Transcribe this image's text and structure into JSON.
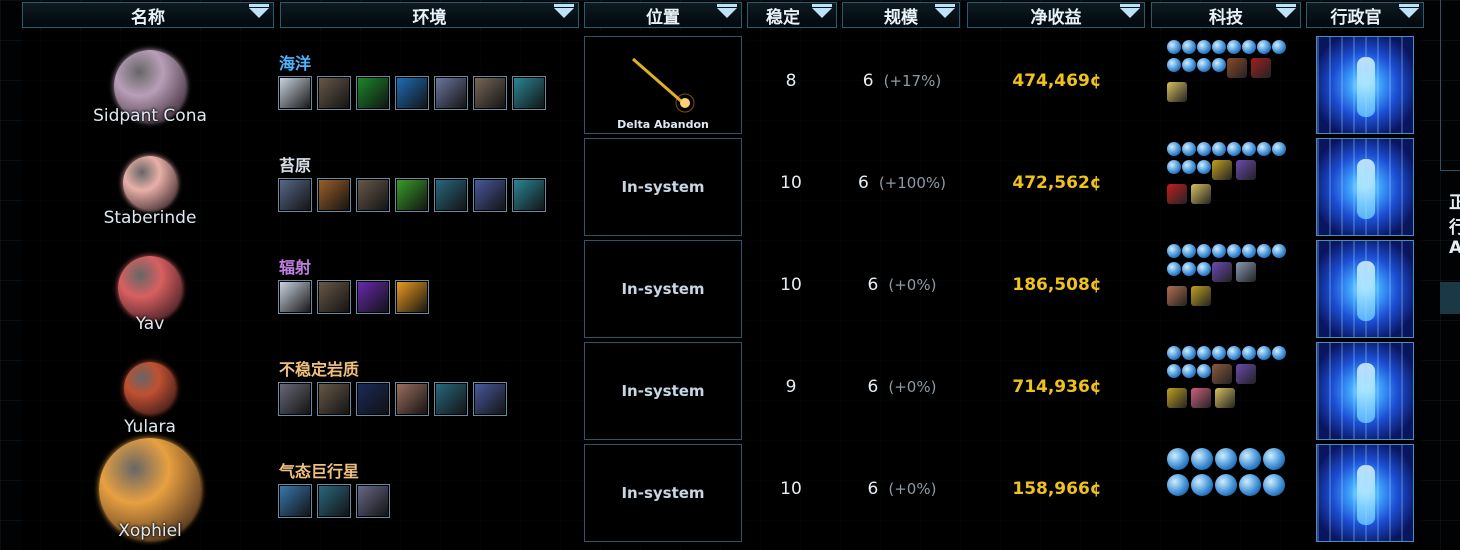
{
  "columns": [
    {
      "key": "name",
      "label": "名称"
    },
    {
      "key": "env",
      "label": "环境"
    },
    {
      "key": "loc",
      "label": "位置"
    },
    {
      "key": "stab",
      "label": "稳定"
    },
    {
      "key": "scale",
      "label": "规模"
    },
    {
      "key": "income",
      "label": "净收益"
    },
    {
      "key": "tech",
      "label": "科技"
    },
    {
      "key": "admin",
      "label": "行政官"
    }
  ],
  "rows": [
    {
      "name": "Sidpant Cona",
      "planet_color": "#b89fb8",
      "env": "海洋",
      "env_color": "#4fb4ff",
      "env_icons": [
        "#cfd8e4",
        "#6a5a4a",
        "#1c8a2c",
        "#1e6fb8",
        "#6d79a0",
        "#7a6a5a",
        "#2a8a9a"
      ],
      "location": "Delta Abandon",
      "location_type": "map",
      "stability": "8",
      "scale": "6",
      "scale_pct": "(+17%)",
      "income": "474,469¢",
      "tech_blue": 12,
      "tech_icons": [
        "#8a4a2a",
        "#a02020",
        "#d8c060"
      ]
    },
    {
      "name": "Staberinde",
      "planet_color": "#e8b0a8",
      "env": "苔原",
      "env_color": "#d8e0e8",
      "env_icons": [
        "#5a6a8a",
        "#a0602a",
        "#6a5a4a",
        "#3aa02a",
        "#2a6a80",
        "#4a5aa0",
        "#2a8a9a"
      ],
      "location": "In-system",
      "location_type": "text",
      "stability": "10",
      "scale": "6",
      "scale_pct": "(+100%)",
      "income": "472,562¢",
      "tech_blue": 11,
      "tech_icons": [
        "#c0a020",
        "#6a4ab0",
        "#c02020",
        "#d8c060"
      ]
    },
    {
      "name": "Yav",
      "planet_color": "#d86060",
      "env": "辐射",
      "env_color": "#c080e0",
      "env_icons": [
        "#cfd8e4",
        "#6a5a4a",
        "#6a2ab0",
        "#f0a020"
      ],
      "location": "In-system",
      "location_type": "text",
      "stability": "10",
      "scale": "6",
      "scale_pct": "(+0%)",
      "income": "186,508¢",
      "tech_blue": 11,
      "tech_icons": [
        "#6a4ab0",
        "#8a9ab0",
        "#b07050",
        "#c0a020"
      ]
    },
    {
      "name": "Yulara",
      "planet_color": "#c05030",
      "env": "不稳定岩质",
      "env_color": "#f0c080",
      "env_icons": [
        "#6a6a7a",
        "#6a5a4a",
        "#1a2a5a",
        "#a07060",
        "#2a6a80",
        "#4a5aa0"
      ],
      "location": "In-system",
      "location_type": "text",
      "stability": "9",
      "scale": "6",
      "scale_pct": "(+0%)",
      "income": "714,936¢",
      "tech_blue": 11,
      "tech_icons": [
        "#8a5a3a",
        "#6a4ab0",
        "#c0a020",
        "#d06080",
        "#d8c060"
      ]
    },
    {
      "name": "Xophiel",
      "planet_color": "#e8a040",
      "env": "气态巨行星",
      "env_color": "#f0c080",
      "env_icons": [
        "#3a7ab0",
        "#2a6a80",
        "#6a6a8a"
      ],
      "location": "In-system",
      "location_type": "text",
      "stability": "10",
      "scale": "6",
      "scale_pct": "(+0%)",
      "income": "158,966¢",
      "tech_blue": 10,
      "tech_icons": []
    }
  ],
  "side_panel": {
    "lines": [
      "正",
      "行",
      "A"
    ]
  }
}
